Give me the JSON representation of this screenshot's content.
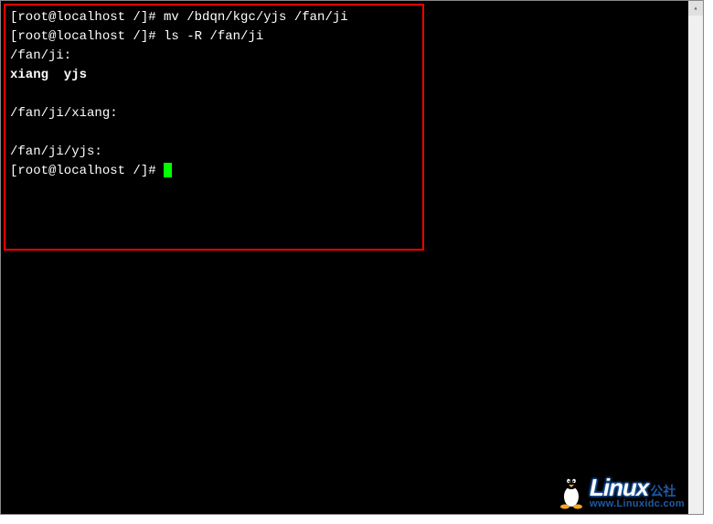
{
  "terminal": {
    "prompt": "[root@localhost /]# ",
    "lines": [
      {
        "type": "cmd",
        "text": "mv /bdqn/kgc/yjs /fan/ji"
      },
      {
        "type": "cmd",
        "text": "ls -R /fan/ji"
      },
      {
        "type": "out",
        "text": "/fan/ji:"
      },
      {
        "type": "out-bold",
        "text": "xiang  yjs"
      },
      {
        "type": "blank",
        "text": ""
      },
      {
        "type": "out",
        "text": "/fan/ji/xiang:"
      },
      {
        "type": "blank",
        "text": ""
      },
      {
        "type": "out",
        "text": "/fan/ji/yjs:"
      },
      {
        "type": "cmd-cursor",
        "text": ""
      }
    ]
  },
  "scrollbar": {
    "up_glyph": "▴"
  },
  "watermark": {
    "brand": "Linux",
    "brand_cn": "公社",
    "url": "www.Linuxidc.com"
  }
}
